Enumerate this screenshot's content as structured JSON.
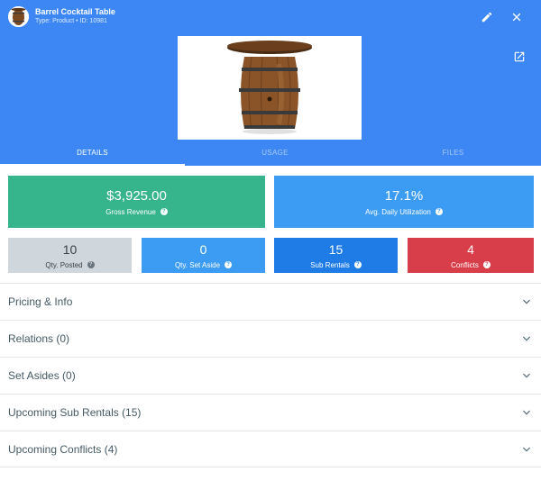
{
  "header": {
    "title": "Barrel Cocktail Table",
    "subtitle": "Type: Product • ID: 10981",
    "edit_icon": "pencil-icon",
    "close_icon": "close-icon",
    "open_icon": "open-in-new-icon",
    "background": "#3d87f5"
  },
  "tabs": [
    {
      "label": "DETAILS",
      "active": true
    },
    {
      "label": "USAGE",
      "active": false
    },
    {
      "label": "FILES",
      "active": false
    }
  ],
  "stats": {
    "gross_revenue": {
      "value": "$3,925.00",
      "label": "Gross Revenue",
      "color": "#36b48c"
    },
    "avg_utilization": {
      "value": "17.1%",
      "label": "Avg. Daily Utilization",
      "color": "#3c9bf2"
    },
    "qty_posted": {
      "value": "10",
      "label": "Qty. Posted",
      "color": "#cfd6dc"
    },
    "qty_set_aside": {
      "value": "0",
      "label": "Qty. Set Aside",
      "color": "#3c9bf2"
    },
    "sub_rentals": {
      "value": "15",
      "label": "Sub Rentals",
      "color": "#1f7be6"
    },
    "conflicts": {
      "value": "4",
      "label": "Conflicts",
      "color": "#d83e4a"
    },
    "help_glyph": "?"
  },
  "sections": [
    {
      "label": "Pricing & Info"
    },
    {
      "label": "Relations (0)"
    },
    {
      "label": "Set Asides (0)"
    },
    {
      "label": "Upcoming Sub Rentals (15)"
    },
    {
      "label": "Upcoming Conflicts (4)"
    }
  ]
}
